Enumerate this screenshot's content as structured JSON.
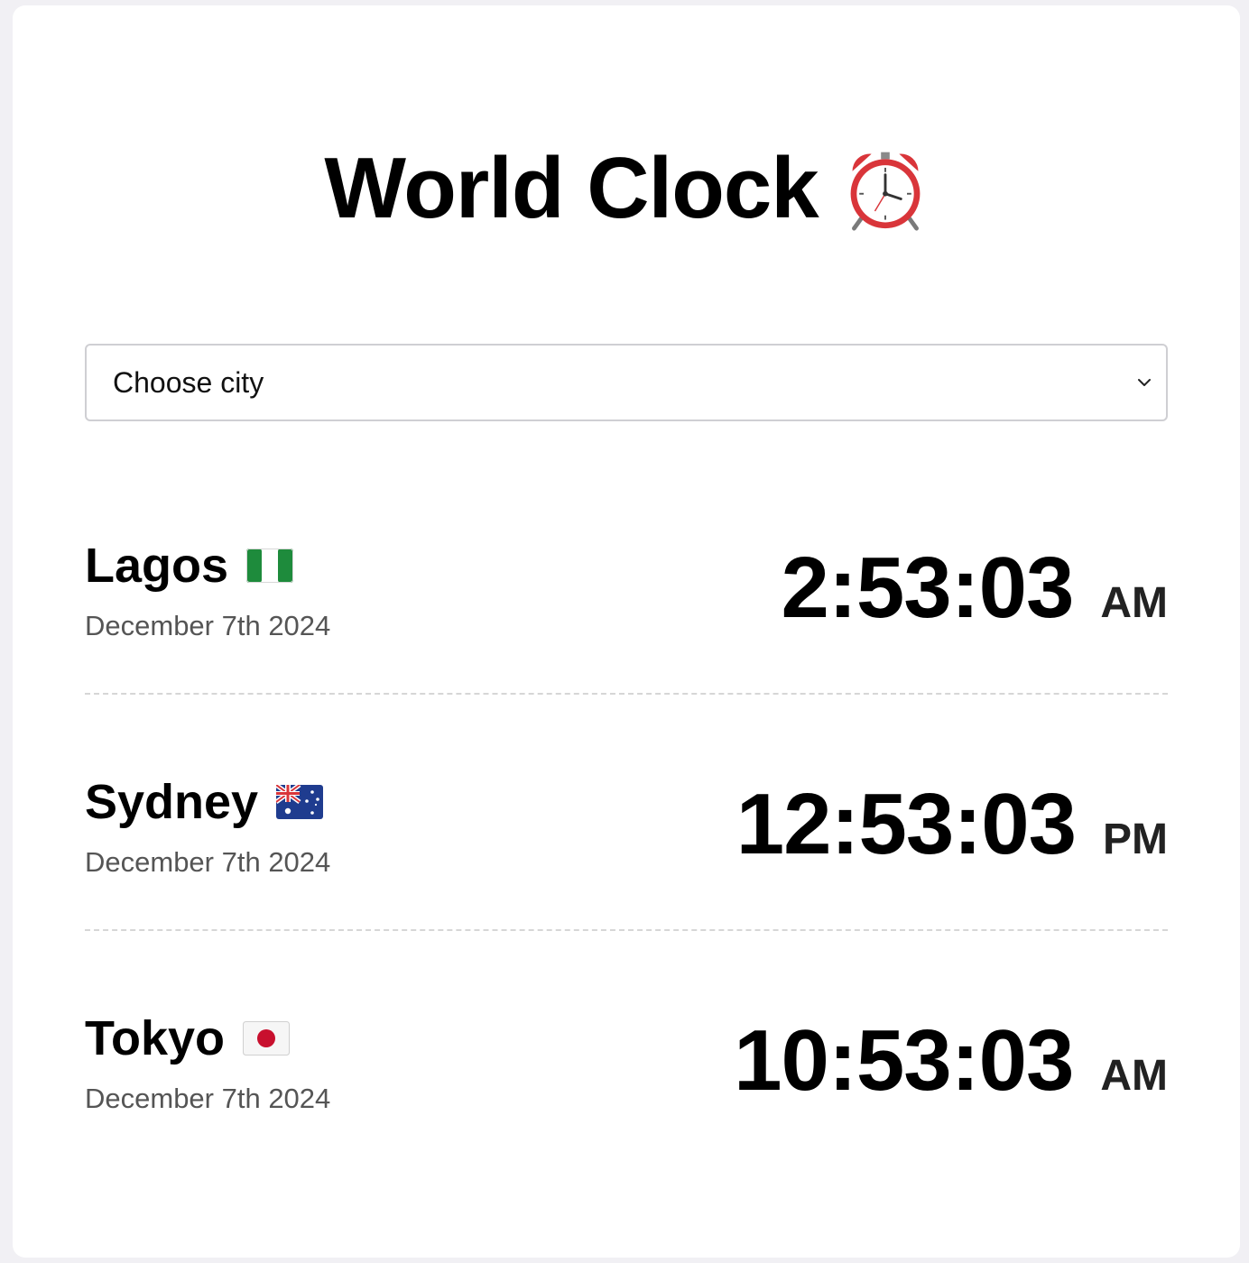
{
  "app": {
    "title": "World Clock",
    "title_icon": "alarm-clock-icon"
  },
  "city_select": {
    "value": "Choose city",
    "icon": "chevron-down-icon"
  },
  "cities": [
    {
      "name": "Lagos",
      "flag": "nigeria-flag-icon",
      "date": "December 7th 2024",
      "time": "2:53:03",
      "period": "AM"
    },
    {
      "name": "Sydney",
      "flag": "australia-flag-icon",
      "date": "December 7th 2024",
      "time": "12:53:03",
      "period": "PM"
    },
    {
      "name": "Tokyo",
      "flag": "japan-flag-icon",
      "date": "December 7th 2024",
      "time": "10:53:03",
      "period": "AM"
    }
  ],
  "colors": {
    "background": "#f1f0f4",
    "card": "#ffffff",
    "date_text": "#555555",
    "divider": "#d6d6d6"
  }
}
